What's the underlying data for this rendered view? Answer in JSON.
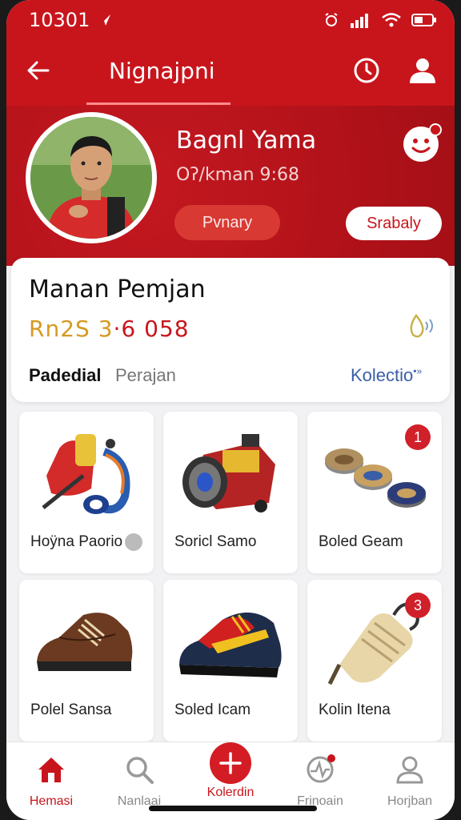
{
  "status_bar": {
    "time": "10301"
  },
  "header": {
    "title": "Nignajpni"
  },
  "profile": {
    "name": "Bagnl Yama",
    "subtitle": "Oʔ/kman 9:68",
    "primary_button": "Pvnary",
    "secondary_button": "Srabaly"
  },
  "summary_card": {
    "title": "Manan Pemjan",
    "amount_part1": "Rn2S 3",
    "amount_part2": "·6 058",
    "label_bold": "Padedial",
    "label_light": "Perajan",
    "link": "Kolectio"
  },
  "products": [
    {
      "name": "Hoÿna Paorio",
      "badge": ""
    },
    {
      "name": "Soricl Samo",
      "badge": ""
    },
    {
      "name": "Boled Geam",
      "badge": "1"
    },
    {
      "name": "Polel Sansa",
      "badge": ""
    },
    {
      "name": "Soled Icam",
      "badge": ""
    },
    {
      "name": "Kolin Itena",
      "badge": "3"
    }
  ],
  "bottom_nav": [
    {
      "label": "Hemasi",
      "icon": "home-icon",
      "active": true
    },
    {
      "label": "Nanlaai",
      "icon": "search-icon",
      "active": false
    },
    {
      "label": "Kolerdin",
      "icon": "add-icon",
      "active": true
    },
    {
      "label": "Frinoain",
      "icon": "activity-icon",
      "active": false
    },
    {
      "label": "Horjban",
      "icon": "profile-icon",
      "active": false
    }
  ],
  "colors": {
    "brand": "#c8151c",
    "accent_gold": "#d49a22",
    "link": "#3a5fa8"
  }
}
